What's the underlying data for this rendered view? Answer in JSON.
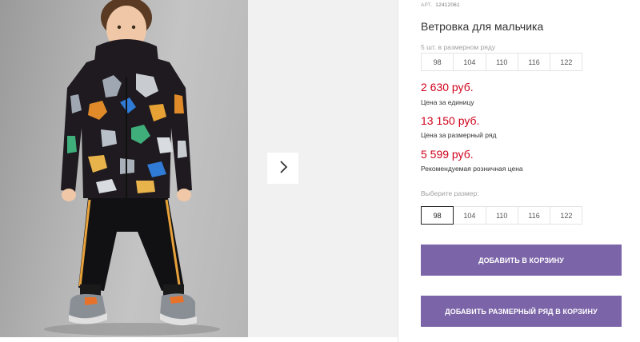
{
  "product": {
    "article_label": "АРТ.",
    "article_value": "12412061",
    "title": "Ветровка для мальчика",
    "pack_note": "5 шт. в размерном ряду",
    "pack_sizes": [
      "98",
      "104",
      "110",
      "116",
      "122"
    ],
    "prices": [
      {
        "value": "2 630 руб.",
        "label": "Цена за единицу"
      },
      {
        "value": "13 150 руб.",
        "label": "Цена за размерный ряд"
      },
      {
        "value": "5 599 руб.",
        "label": "Рекомендуемая розничная цена"
      }
    ],
    "choose_size_label": "Выберите размер:",
    "select_sizes": [
      "98",
      "104",
      "110",
      "116",
      "122"
    ],
    "selected_size": "98"
  },
  "actions": {
    "add_to_cart": "ДОБАВИТЬ В КОРЗИНУ",
    "add_pack_to_cart": "ДОБАВИТЬ РАЗМЕРНЫЙ РЯД В КОРЗИНУ"
  },
  "gallery": {
    "next_icon": "chevron-right-icon"
  },
  "colors": {
    "price": "#d0021b",
    "button": "#7b64a8",
    "selected_border": "#222222"
  }
}
